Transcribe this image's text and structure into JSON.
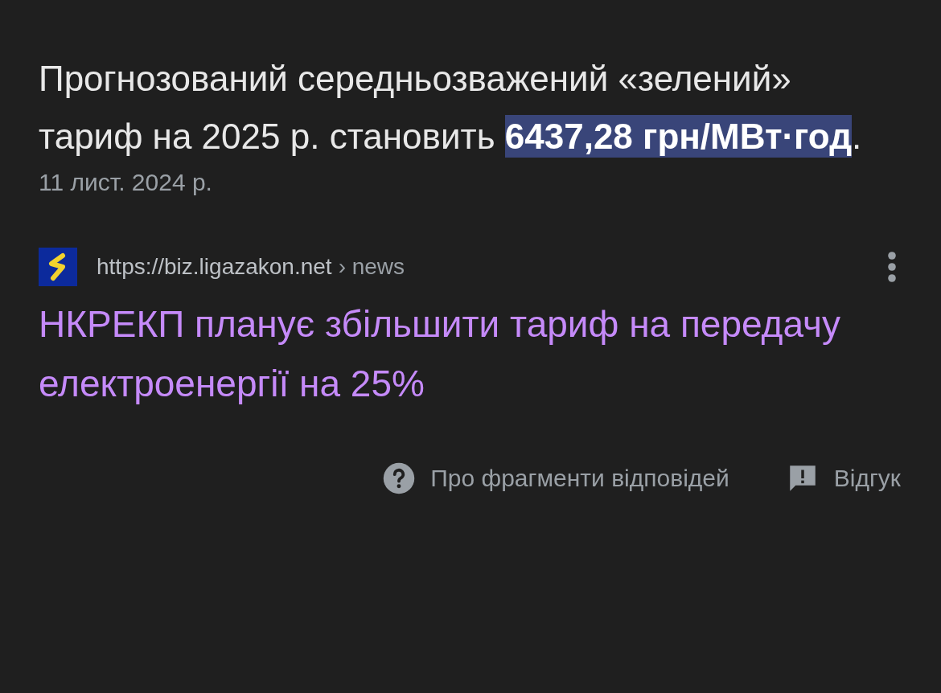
{
  "snippet": {
    "text_before": "Прогнозований середньозважений «зелений» тариф на 2025 р. становить ",
    "highlight": "6437,28 грн/МВт·год",
    "text_after": "."
  },
  "date": "11 лист. 2024 р.",
  "source": {
    "url": "https://biz.ligazakon.net",
    "path": "› news"
  },
  "result_title": "НКРЕКП планує збільшити тариф на передачу електроенергії на 25%",
  "footer": [
    {
      "kind": "about",
      "label": "Про фрагменти відповідей"
    },
    {
      "kind": "feedback",
      "label": "Відгук"
    }
  ]
}
